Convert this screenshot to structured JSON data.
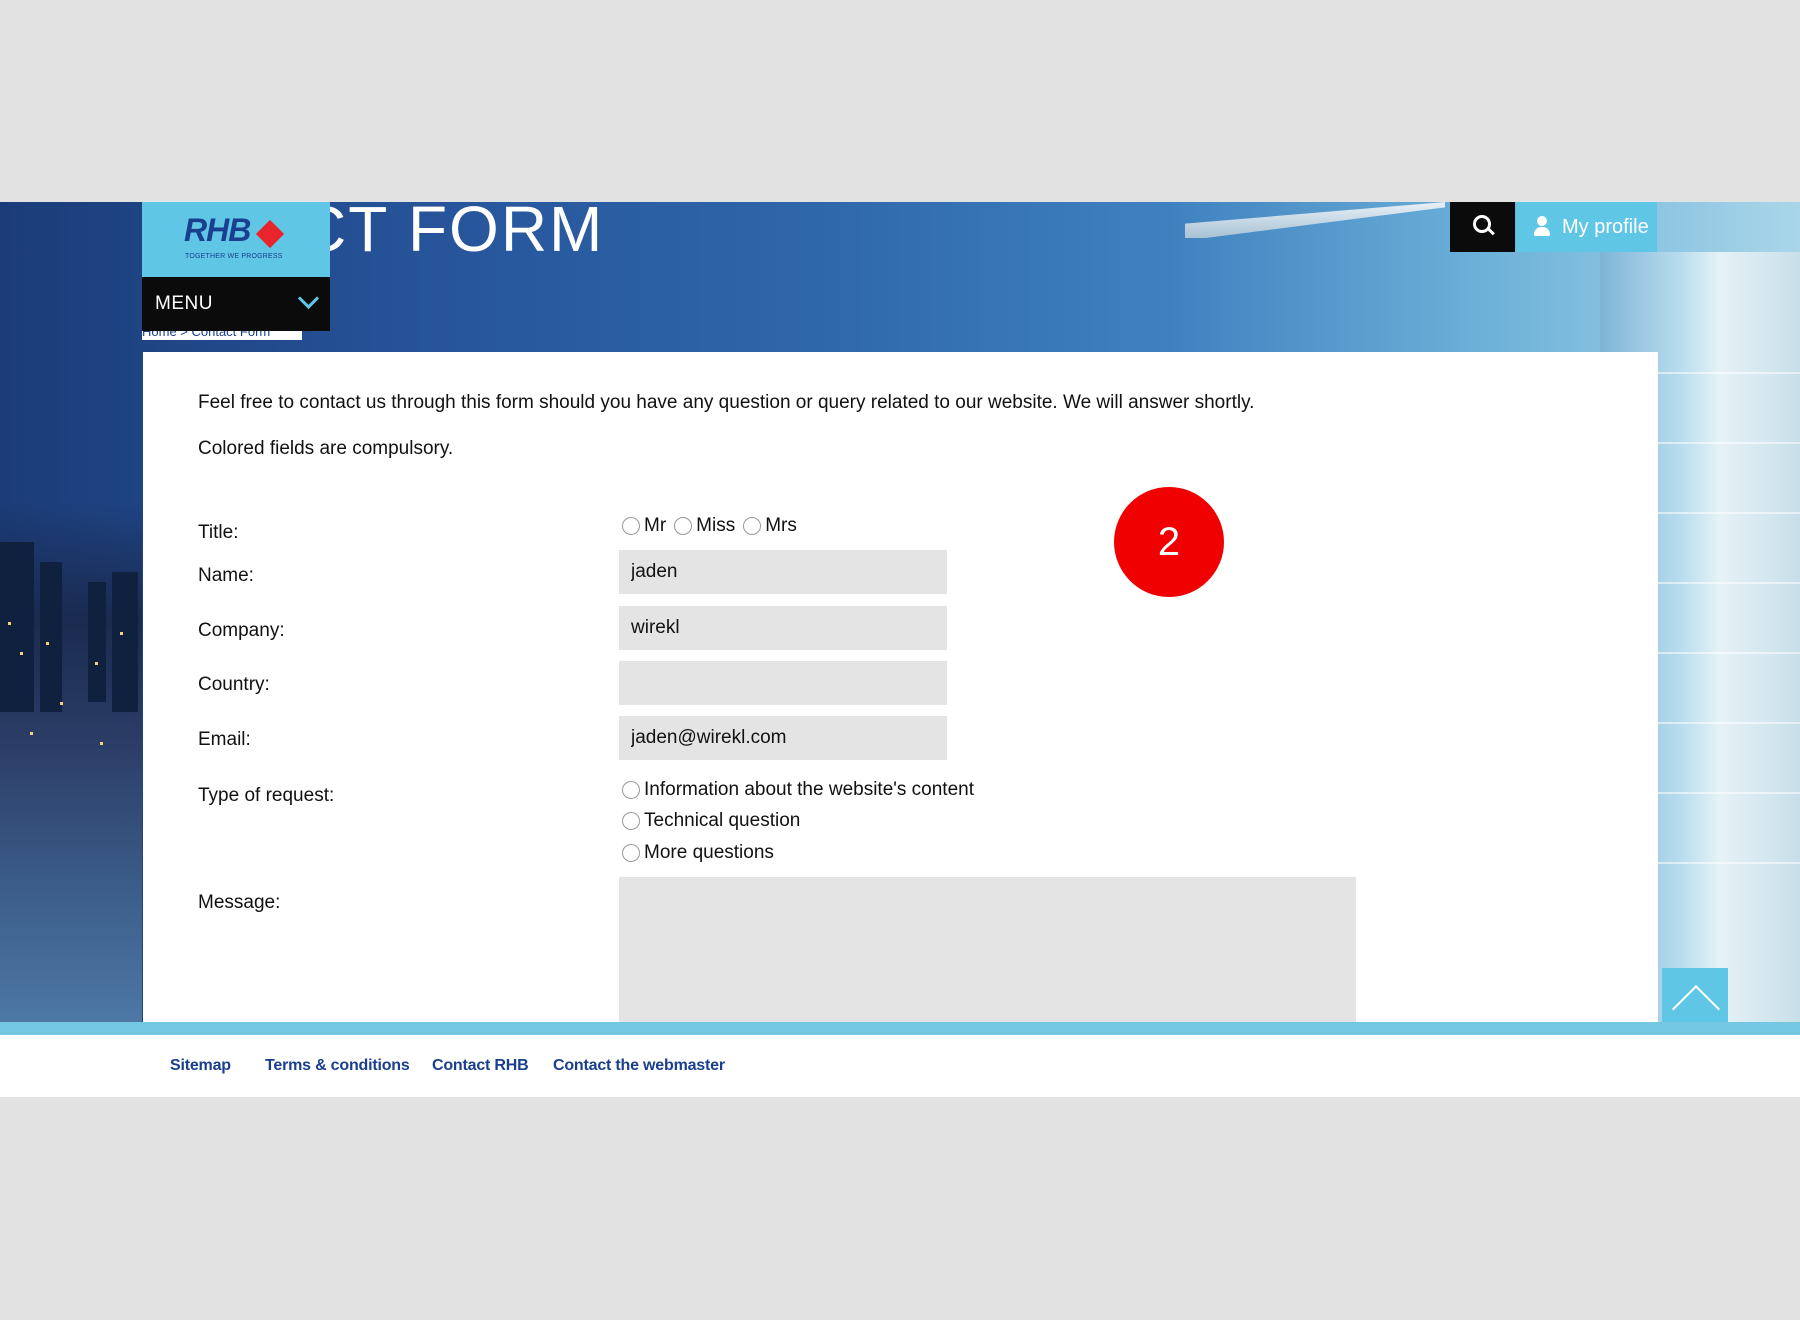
{
  "header": {
    "page_title": "CT FORM",
    "logo": {
      "name": "RHB",
      "tagline": "TOGETHER WE PROGRESS"
    },
    "menu_label": "MENU",
    "breadcrumb": "Home  >  Contact Form",
    "my_profile_label": "My profile"
  },
  "form": {
    "intro": "Feel free to contact us through this form should you have any question or query related to our website. We will answer shortly.",
    "compulsory_note": "Colored fields are compulsory.",
    "title_label": "Title:",
    "title_options": [
      "Mr",
      "Miss",
      "Mrs"
    ],
    "name_label": "Name:",
    "name_value": "jaden",
    "company_label": "Company:",
    "company_value": "wirekl",
    "country_label": "Country:",
    "country_value": "",
    "email_label": "Email:",
    "email_value": "jaden@wirekl.com",
    "request_label": "Type of request:",
    "request_options": [
      "Information about the website's content",
      "Technical question",
      "More questions"
    ],
    "message_label": "Message:",
    "message_value": ""
  },
  "badge": {
    "number": "2",
    "color": "#f00000"
  },
  "footer": {
    "links": [
      "Sitemap",
      "Terms & conditions",
      "Contact RHB",
      "Contact the webmaster"
    ]
  },
  "colors": {
    "accent": "#5fc6e6",
    "link": "#1a3f8e",
    "field": "#e4e4e4",
    "logo_diamond": "#e8252d"
  },
  "icons": {
    "search": "search-icon",
    "profile": "user-icon",
    "menu": "chevron-down-icon",
    "to_top": "chevron-up-icon"
  }
}
